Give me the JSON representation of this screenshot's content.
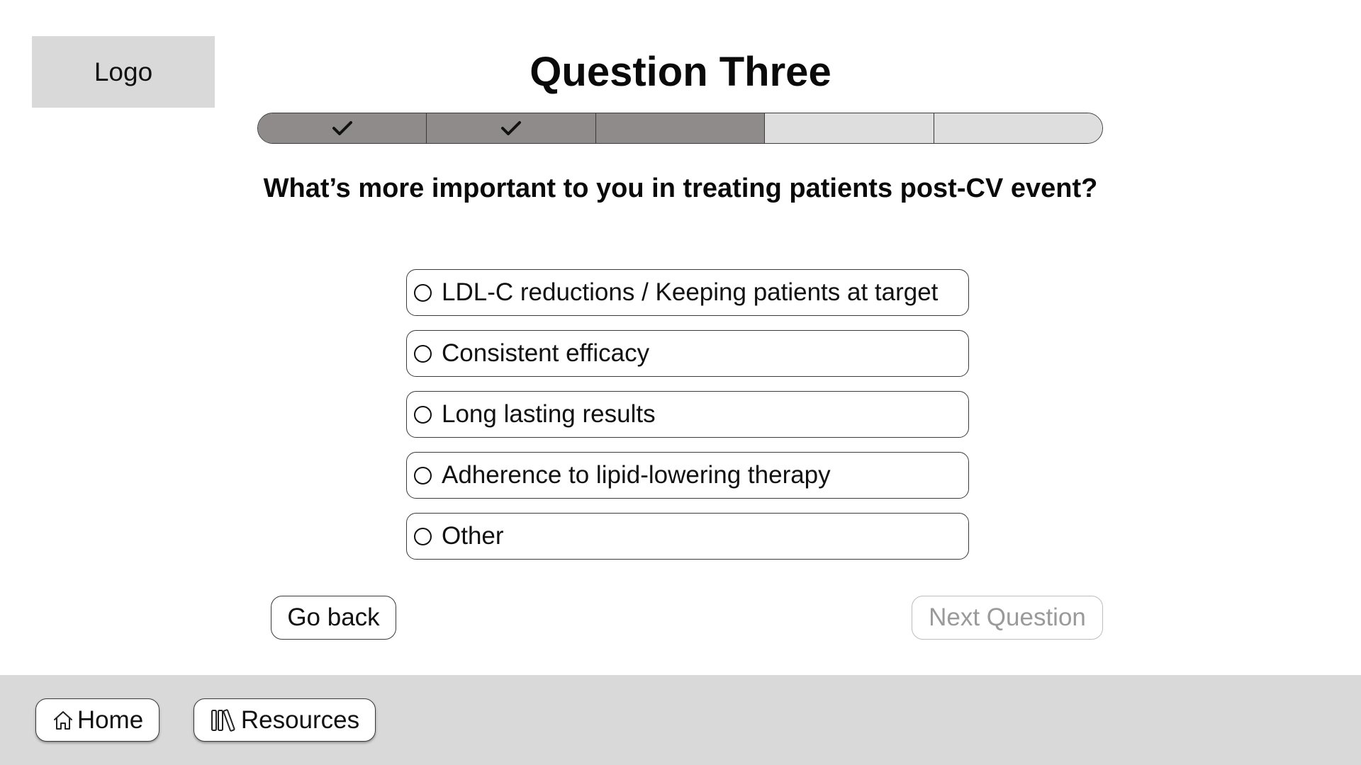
{
  "logo": {
    "label": "Logo"
  },
  "header": {
    "title": "Question Three"
  },
  "progress": {
    "total_steps": 5,
    "current_step": 3,
    "steps": [
      {
        "state": "completed",
        "icon": "check-icon"
      },
      {
        "state": "completed",
        "icon": "check-icon"
      },
      {
        "state": "current",
        "icon": ""
      },
      {
        "state": "pending",
        "icon": ""
      },
      {
        "state": "pending",
        "icon": ""
      }
    ],
    "colors": {
      "filled": "#8f8b8b",
      "empty": "#dedede"
    }
  },
  "question": {
    "text": "What’s more important to you in treating patients post-CV event?"
  },
  "options": [
    {
      "label": "LDL-C reductions / Keeping patients at target",
      "selected": false
    },
    {
      "label": "Consistent efficacy",
      "selected": false
    },
    {
      "label": "Long lasting results",
      "selected": false
    },
    {
      "label": "Adherence to lipid-lowering therapy",
      "selected": false
    },
    {
      "label": "Other",
      "selected": false
    }
  ],
  "navigation": {
    "back_label": "Go back",
    "next_label": "Next Question",
    "next_enabled": false
  },
  "footer": {
    "home_label": "Home",
    "home_icon": "home-icon",
    "resources_label": "Resources",
    "resources_icon": "library-books-icon"
  }
}
